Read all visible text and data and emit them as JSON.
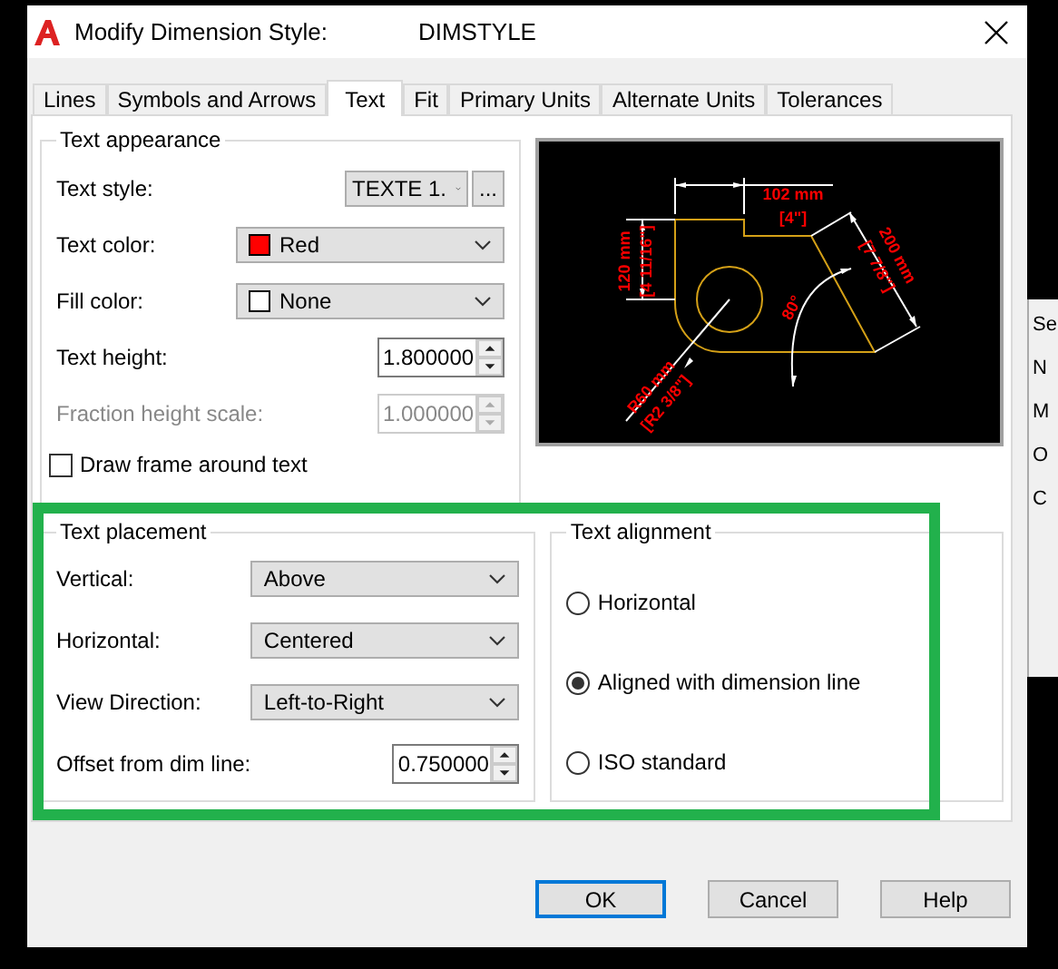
{
  "window": {
    "title": "Modify Dimension Style:",
    "style_name": "DIMSTYLE"
  },
  "tabs": [
    {
      "label": "Lines",
      "selected": false
    },
    {
      "label": "Symbols and Arrows",
      "selected": false
    },
    {
      "label": "Text",
      "selected": true
    },
    {
      "label": "Fit",
      "selected": false
    },
    {
      "label": "Primary Units",
      "selected": false
    },
    {
      "label": "Alternate Units",
      "selected": false
    },
    {
      "label": "Tolerances",
      "selected": false
    }
  ],
  "text_appearance": {
    "title": "Text appearance",
    "fields": [
      {
        "kind": "style",
        "label": "Text style:",
        "value": "TEXTE 1.",
        "browse": "..."
      },
      {
        "kind": "color",
        "label": "Text color:",
        "value": "Red",
        "color": "#ff0000"
      },
      {
        "kind": "color",
        "label": "Fill color:",
        "value": "None",
        "color": "#ffffff"
      },
      {
        "kind": "spin",
        "label": "Text height:",
        "value": "1.800000",
        "disabled": false
      },
      {
        "kind": "spin",
        "label": "Fraction height scale:",
        "value": "1.000000",
        "disabled": true
      },
      {
        "kind": "checkbox",
        "label": "Draw frame around text",
        "checked": false
      }
    ]
  },
  "preview": {
    "labels": [
      {
        "text": "102 mm",
        "kind": "top"
      },
      {
        "text": "[4\"]",
        "kind": "top2"
      },
      {
        "text": "120 mm",
        "kind": "left"
      },
      {
        "text": "[4 11/16\"]",
        "kind": "left2"
      },
      {
        "text": "200 mm",
        "kind": "slant"
      },
      {
        "text": "[7 7/8\"]",
        "kind": "slant2"
      },
      {
        "text": "80°",
        "kind": "angle"
      },
      {
        "text": "R60 mm",
        "kind": "radius"
      },
      {
        "text": "[R2 3/8\"]",
        "kind": "radius2"
      }
    ]
  },
  "text_placement": {
    "title": "Text placement",
    "fields": [
      {
        "kind": "combo",
        "label": "Vertical:",
        "value": "Above"
      },
      {
        "kind": "combo",
        "label": "Horizontal:",
        "value": "Centered"
      },
      {
        "kind": "combo",
        "label": "View Direction:",
        "value": "Left-to-Right"
      },
      {
        "kind": "spin",
        "label": "Offset from dim line:",
        "value": "0.750000",
        "disabled": false
      }
    ]
  },
  "text_alignment": {
    "title": "Text alignment",
    "options": [
      {
        "label": "Horizontal",
        "selected": false
      },
      {
        "label": "Aligned with dimension line",
        "selected": true
      },
      {
        "label": "ISO standard",
        "selected": false
      }
    ]
  },
  "buttons": [
    {
      "label": "OK",
      "default": true
    },
    {
      "label": "Cancel",
      "default": false
    },
    {
      "label": "Help",
      "default": false
    }
  ],
  "background_fragments": [
    "Se",
    "N",
    "M",
    "O",
    "C"
  ]
}
